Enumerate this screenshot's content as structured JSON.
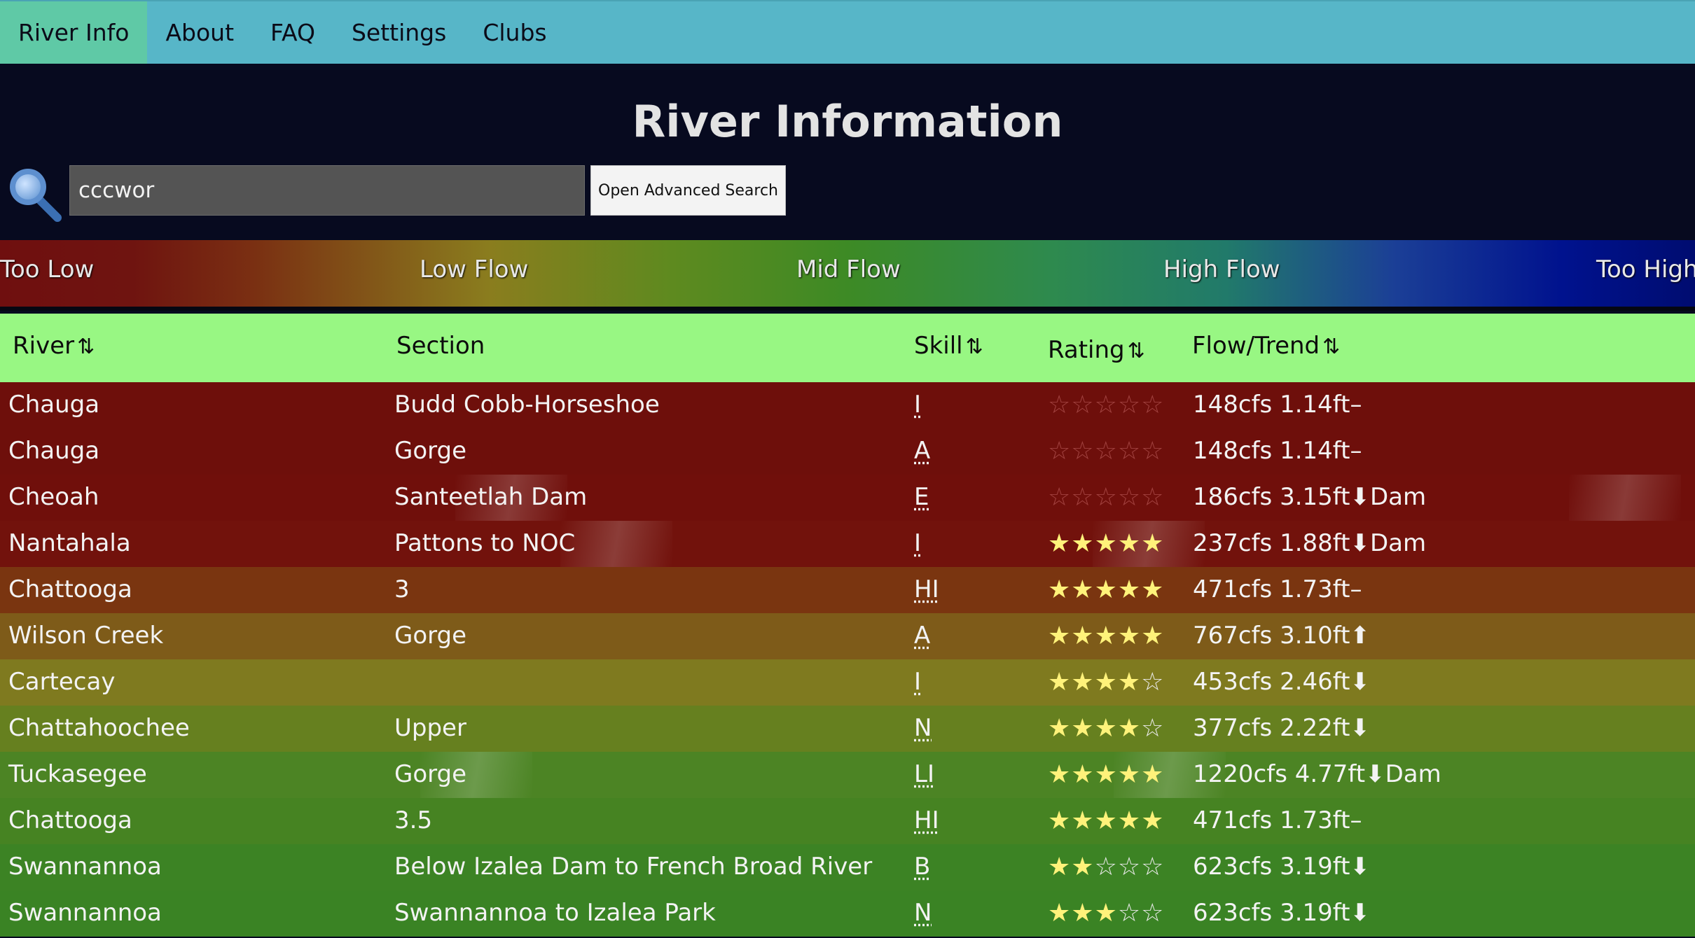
{
  "nav": {
    "items": [
      {
        "label": "River Info",
        "active": true
      },
      {
        "label": "About"
      },
      {
        "label": "FAQ"
      },
      {
        "label": "Settings"
      },
      {
        "label": "Clubs"
      }
    ]
  },
  "header": {
    "title": "River Information"
  },
  "search": {
    "value": "cccwor",
    "icon": "search-icon",
    "advanced_button": "Open Advanced Search"
  },
  "legend": {
    "labels": [
      "Too Low",
      "Low Flow",
      "Mid Flow",
      "High Flow",
      "Too High"
    ]
  },
  "table": {
    "headers": {
      "river": "River",
      "section": "Section",
      "skill": "Skill",
      "rating": "Rating",
      "flow": "Flow/Trend",
      "sort_glyph": "⇅"
    },
    "rows": [
      {
        "river": "Chauga",
        "section": "Budd Cobb-Horseshoe",
        "skill": "I",
        "stars": 0,
        "flow": "148cfs 1.14ft",
        "trend": "–",
        "dam": "",
        "color": "#6e0f0b"
      },
      {
        "river": "Chauga",
        "section": "Gorge",
        "skill": "A",
        "stars": 0,
        "flow": "148cfs 1.14ft",
        "trend": "–",
        "dam": "",
        "color": "#6e0f0b"
      },
      {
        "river": "Cheoah",
        "section": "Santeetlah Dam",
        "skill": "E",
        "stars": 0,
        "flow": "186cfs 3.15ft",
        "trend": "⬇",
        "dam": "Dam",
        "color": "#700f0b"
      },
      {
        "river": "Nantahala",
        "section": "Pattons to NOC",
        "skill": "I",
        "stars": 5,
        "flow": "237cfs 1.88ft",
        "trend": "⬇",
        "dam": "Dam",
        "color": "#72120c"
      },
      {
        "river": "Chattooga",
        "section": "3",
        "skill": "HI",
        "stars": 5,
        "flow": "471cfs 1.73ft",
        "trend": "–",
        "dam": "",
        "color": "#7a3510"
      },
      {
        "river": "Wilson Creek",
        "section": "Gorge",
        "skill": "A",
        "stars": 5,
        "flow": "767cfs 3.10ft",
        "trend": "⬆",
        "dam": "",
        "color": "#7e5b19"
      },
      {
        "river": "Cartecay",
        "section": "",
        "skill": "I",
        "stars": 4,
        "flow": "453cfs 2.46ft",
        "trend": "⬇",
        "dam": "",
        "color": "#7f7a1f"
      },
      {
        "river": "Chattahoochee",
        "section": "Upper",
        "skill": "N",
        "stars": 4,
        "flow": "377cfs 2.22ft",
        "trend": "⬇",
        "dam": "",
        "color": "#66801f"
      },
      {
        "river": "Tuckasegee",
        "section": "Gorge",
        "skill": "LI",
        "stars": 5,
        "flow": "1220cfs 4.77ft",
        "trend": "⬇",
        "dam": "Dam",
        "color": "#4c8424"
      },
      {
        "river": "Chattooga",
        "section": "3.5",
        "skill": "HI",
        "stars": 5,
        "flow": "471cfs 1.73ft",
        "trend": "–",
        "dam": "",
        "color": "#468322"
      },
      {
        "river": "Swannannoa",
        "section": "Below Izalea Dam to French Broad River",
        "skill": "B",
        "stars": 2,
        "flow": "623cfs 3.19ft",
        "trend": "⬇",
        "dam": "",
        "color": "#3c8324"
      },
      {
        "river": "Swannannoa",
        "section": "Swannannoa to Izalea Park",
        "skill": "N",
        "stars": 3,
        "flow": "623cfs 3.19ft",
        "trend": "⬇",
        "dam": "",
        "color": "#3a8324"
      }
    ]
  }
}
